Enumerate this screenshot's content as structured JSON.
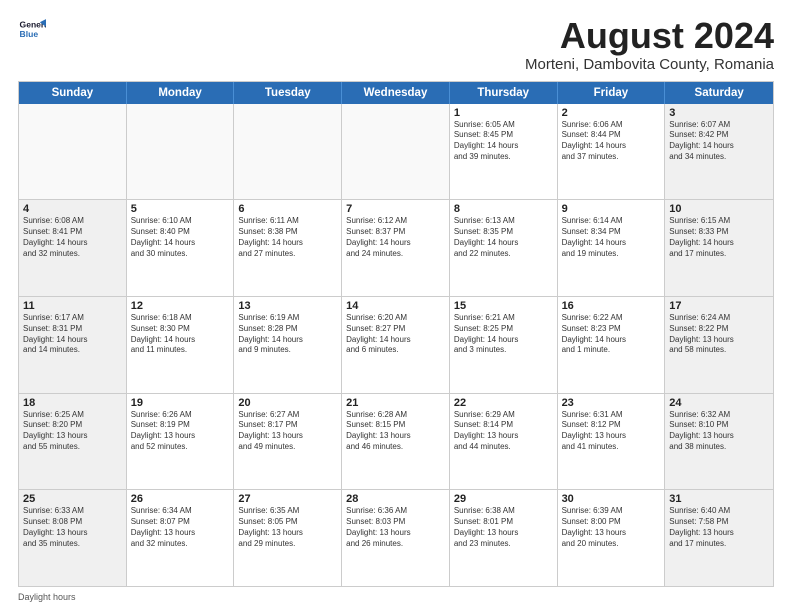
{
  "logo": {
    "line1": "General",
    "line2": "Blue"
  },
  "title": "August 2024",
  "subtitle": "Morteni, Dambovita County, Romania",
  "weekdays": [
    "Sunday",
    "Monday",
    "Tuesday",
    "Wednesday",
    "Thursday",
    "Friday",
    "Saturday"
  ],
  "footer_text": "Daylight hours",
  "weeks": [
    [
      {
        "day": "",
        "text": "",
        "empty": true
      },
      {
        "day": "",
        "text": "",
        "empty": true
      },
      {
        "day": "",
        "text": "",
        "empty": true
      },
      {
        "day": "",
        "text": "",
        "empty": true
      },
      {
        "day": "1",
        "text": "Sunrise: 6:05 AM\nSunset: 8:45 PM\nDaylight: 14 hours\nand 39 minutes."
      },
      {
        "day": "2",
        "text": "Sunrise: 6:06 AM\nSunset: 8:44 PM\nDaylight: 14 hours\nand 37 minutes."
      },
      {
        "day": "3",
        "text": "Sunrise: 6:07 AM\nSunset: 8:42 PM\nDaylight: 14 hours\nand 34 minutes."
      }
    ],
    [
      {
        "day": "4",
        "text": "Sunrise: 6:08 AM\nSunset: 8:41 PM\nDaylight: 14 hours\nand 32 minutes."
      },
      {
        "day": "5",
        "text": "Sunrise: 6:10 AM\nSunset: 8:40 PM\nDaylight: 14 hours\nand 30 minutes."
      },
      {
        "day": "6",
        "text": "Sunrise: 6:11 AM\nSunset: 8:38 PM\nDaylight: 14 hours\nand 27 minutes."
      },
      {
        "day": "7",
        "text": "Sunrise: 6:12 AM\nSunset: 8:37 PM\nDaylight: 14 hours\nand 24 minutes."
      },
      {
        "day": "8",
        "text": "Sunrise: 6:13 AM\nSunset: 8:35 PM\nDaylight: 14 hours\nand 22 minutes."
      },
      {
        "day": "9",
        "text": "Sunrise: 6:14 AM\nSunset: 8:34 PM\nDaylight: 14 hours\nand 19 minutes."
      },
      {
        "day": "10",
        "text": "Sunrise: 6:15 AM\nSunset: 8:33 PM\nDaylight: 14 hours\nand 17 minutes."
      }
    ],
    [
      {
        "day": "11",
        "text": "Sunrise: 6:17 AM\nSunset: 8:31 PM\nDaylight: 14 hours\nand 14 minutes."
      },
      {
        "day": "12",
        "text": "Sunrise: 6:18 AM\nSunset: 8:30 PM\nDaylight: 14 hours\nand 11 minutes."
      },
      {
        "day": "13",
        "text": "Sunrise: 6:19 AM\nSunset: 8:28 PM\nDaylight: 14 hours\nand 9 minutes."
      },
      {
        "day": "14",
        "text": "Sunrise: 6:20 AM\nSunset: 8:27 PM\nDaylight: 14 hours\nand 6 minutes."
      },
      {
        "day": "15",
        "text": "Sunrise: 6:21 AM\nSunset: 8:25 PM\nDaylight: 14 hours\nand 3 minutes."
      },
      {
        "day": "16",
        "text": "Sunrise: 6:22 AM\nSunset: 8:23 PM\nDaylight: 14 hours\nand 1 minute."
      },
      {
        "day": "17",
        "text": "Sunrise: 6:24 AM\nSunset: 8:22 PM\nDaylight: 13 hours\nand 58 minutes."
      }
    ],
    [
      {
        "day": "18",
        "text": "Sunrise: 6:25 AM\nSunset: 8:20 PM\nDaylight: 13 hours\nand 55 minutes."
      },
      {
        "day": "19",
        "text": "Sunrise: 6:26 AM\nSunset: 8:19 PM\nDaylight: 13 hours\nand 52 minutes."
      },
      {
        "day": "20",
        "text": "Sunrise: 6:27 AM\nSunset: 8:17 PM\nDaylight: 13 hours\nand 49 minutes."
      },
      {
        "day": "21",
        "text": "Sunrise: 6:28 AM\nSunset: 8:15 PM\nDaylight: 13 hours\nand 46 minutes."
      },
      {
        "day": "22",
        "text": "Sunrise: 6:29 AM\nSunset: 8:14 PM\nDaylight: 13 hours\nand 44 minutes."
      },
      {
        "day": "23",
        "text": "Sunrise: 6:31 AM\nSunset: 8:12 PM\nDaylight: 13 hours\nand 41 minutes."
      },
      {
        "day": "24",
        "text": "Sunrise: 6:32 AM\nSunset: 8:10 PM\nDaylight: 13 hours\nand 38 minutes."
      }
    ],
    [
      {
        "day": "25",
        "text": "Sunrise: 6:33 AM\nSunset: 8:08 PM\nDaylight: 13 hours\nand 35 minutes."
      },
      {
        "day": "26",
        "text": "Sunrise: 6:34 AM\nSunset: 8:07 PM\nDaylight: 13 hours\nand 32 minutes."
      },
      {
        "day": "27",
        "text": "Sunrise: 6:35 AM\nSunset: 8:05 PM\nDaylight: 13 hours\nand 29 minutes."
      },
      {
        "day": "28",
        "text": "Sunrise: 6:36 AM\nSunset: 8:03 PM\nDaylight: 13 hours\nand 26 minutes."
      },
      {
        "day": "29",
        "text": "Sunrise: 6:38 AM\nSunset: 8:01 PM\nDaylight: 13 hours\nand 23 minutes."
      },
      {
        "day": "30",
        "text": "Sunrise: 6:39 AM\nSunset: 8:00 PM\nDaylight: 13 hours\nand 20 minutes."
      },
      {
        "day": "31",
        "text": "Sunrise: 6:40 AM\nSunset: 7:58 PM\nDaylight: 13 hours\nand 17 minutes."
      }
    ]
  ]
}
